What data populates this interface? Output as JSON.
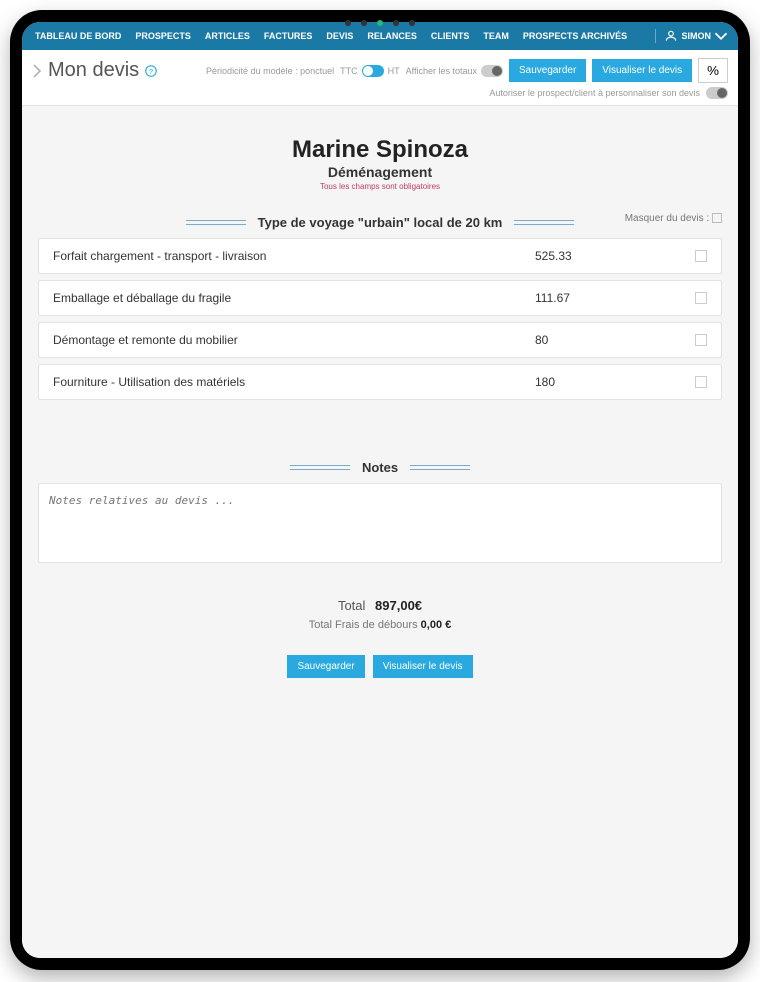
{
  "nav": {
    "items": [
      "TABLEAU DE BORD",
      "PROSPECTS",
      "ARTICLES",
      "FACTURES",
      "DEVIS",
      "RELANCES",
      "CLIENTS",
      "TEAM",
      "PROSPECTS ARCHIVÉS"
    ],
    "user": "SIMON"
  },
  "secondary": {
    "title": "Mon devis",
    "periodicity": "Périodicité du modèle : ponctuel",
    "ttc": "TTC",
    "ht": "HT",
    "show_totals": "Afficher les totaux",
    "save": "Sauvegarder",
    "view": "Visualiser le devis",
    "percent": "%",
    "authorize": "Autoriser le prospect/client à personnaliser son devis"
  },
  "client": {
    "name": "Marine Spinoza",
    "subtitle": "Déménagement",
    "required": "Tous les champs sont obligatoires"
  },
  "section": {
    "title": "Type de voyage \"urbain\" local de 20 km",
    "hide_label": "Masquer du devis :"
  },
  "lines": [
    {
      "label": "Forfait chargement - transport - livraison",
      "value": "525.33"
    },
    {
      "label": "Emballage et déballage du fragile",
      "value": "111.67"
    },
    {
      "label": "Démontage et remonte du mobilier",
      "value": "80"
    },
    {
      "label": "Fourniture - Utilisation des matériels",
      "value": "180"
    }
  ],
  "notes": {
    "title": "Notes",
    "placeholder": "Notes relatives au devis ..."
  },
  "totals": {
    "label": "Total",
    "value": "897,00€",
    "fees_label": "Total Frais de débours",
    "fees_value": "0,00 €"
  },
  "bottom": {
    "save": "Sauvegarder",
    "view": "Visualiser le devis"
  }
}
